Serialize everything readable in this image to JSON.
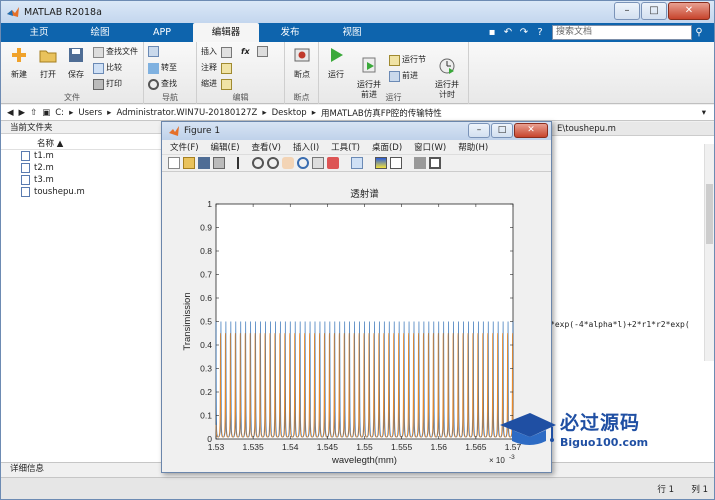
{
  "window": {
    "title": "MATLAB R2018a",
    "minimize": "–",
    "maximize": "□",
    "close": "✕"
  },
  "tabs": [
    {
      "label": "主页",
      "active": false,
      "width": 60
    },
    {
      "label": "绘图",
      "active": false,
      "width": 62
    },
    {
      "label": "APP",
      "active": false,
      "width": 62
    },
    {
      "label": "编辑器",
      "active": true,
      "width": 66
    },
    {
      "label": "发布",
      "active": false,
      "width": 62
    },
    {
      "label": "视图",
      "active": false,
      "width": 62
    }
  ],
  "search": {
    "placeholder": "搜索文档"
  },
  "ribbon": {
    "file": {
      "group": "文件",
      "new": "新建",
      "open": "打开",
      "save": "保存",
      "find_files": "查找文件",
      "compare": "比较",
      "print": "打印"
    },
    "navigate": {
      "group": "导航",
      "goto": "转至",
      "find": "查找"
    },
    "edit": {
      "group": "编辑",
      "insert": "插入",
      "comment": "注释",
      "indent": "缩进",
      "fx": "fx"
    },
    "breakpoints": {
      "group": "断点",
      "label": "断点"
    },
    "run": {
      "group": "运行",
      "run": "运行",
      "run_advance": "运行并\n前进",
      "run_section": "运行节",
      "advance": "前进",
      "run_time": "运行并\n计时"
    }
  },
  "address": {
    "drive": "C:",
    "parts": [
      "Users",
      "Administrator.WIN7U-20180127Z",
      "Desktop",
      "用MATLAB仿真FP腔的传输特性"
    ]
  },
  "current_folder": {
    "title": "当前文件夹",
    "column": "名称 ▲",
    "files": [
      "t1.m",
      "t2.m",
      "t3.m",
      "toushepu.m"
    ]
  },
  "editor": {
    "tab": "E\\toushepu.m",
    "code": "*exp(-4*alpha*l)+2*r1*r2*exp("
  },
  "details": {
    "title": "详细信息"
  },
  "status": {
    "row_label": "行",
    "row": "1",
    "col_label": "列",
    "col": "1"
  },
  "figure": {
    "title": "Figure 1",
    "menu": [
      "文件(F)",
      "编辑(E)",
      "查看(V)",
      "插入(I)",
      "工具(T)",
      "桌面(D)",
      "窗口(W)",
      "帮助(H)"
    ]
  },
  "watermark": {
    "main": "必过源码",
    "sub": "Biguo100.com"
  },
  "chart_data": {
    "type": "line",
    "title": "透射谱",
    "xlabel": "wavelegth(mm)",
    "ylabel": "Transimission",
    "x_exponent": "× 10",
    "x_exponent_power": "-3",
    "xlim": [
      0.00153,
      0.00157
    ],
    "ylim": [
      0,
      1
    ],
    "xticks": [
      "1.53",
      "1.535",
      "1.54",
      "1.545",
      "1.55",
      "1.555",
      "1.56",
      "1.565",
      "1.57"
    ],
    "yticks": [
      "0",
      "0.1",
      "0.2",
      "0.3",
      "0.4",
      "0.5",
      "0.6",
      "0.7",
      "0.8",
      "0.9",
      "1"
    ],
    "grid": false,
    "series": [
      {
        "color": "#2f6fb6",
        "peak": 0.5,
        "num_peaks": 60
      },
      {
        "color": "#e8892a",
        "peak": 0.485,
        "num_peaks": 60
      }
    ]
  }
}
